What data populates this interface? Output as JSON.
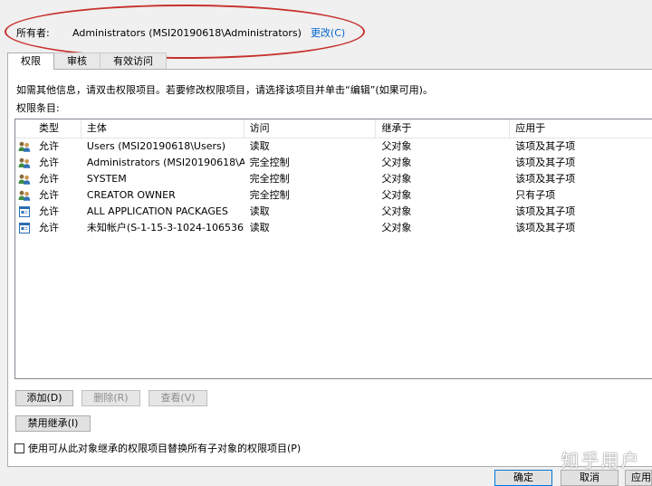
{
  "owner": {
    "label": "所有者:",
    "value": "Administrators (MSI20190618\\Administrators)",
    "change_link": "更改(C)"
  },
  "tabs": [
    {
      "label": "权限",
      "active": true
    },
    {
      "label": "审核",
      "active": false
    },
    {
      "label": "有效访问",
      "active": false
    }
  ],
  "instructions": "如需其他信息，请双击权限项目。若要修改权限项目，请选择该项目并单击“编辑”(如果可用)。",
  "entries_label": "权限条目:",
  "grid": {
    "headers": [
      "类型",
      "主体",
      "访问",
      "继承于",
      "应用于"
    ],
    "rows": [
      {
        "icon": "user-group-icon",
        "type": "允许",
        "principal": "Users (MSI20190618\\Users)",
        "access": "读取",
        "inherited_from": "父对象",
        "applies_to": "该项及其子项"
      },
      {
        "icon": "user-group-icon",
        "type": "允许",
        "principal": "Administrators (MSI20190618\\A...",
        "access": "完全控制",
        "inherited_from": "父对象",
        "applies_to": "该项及其子项"
      },
      {
        "icon": "user-group-icon",
        "type": "允许",
        "principal": "SYSTEM",
        "access": "完全控制",
        "inherited_from": "父对象",
        "applies_to": "该项及其子项"
      },
      {
        "icon": "user-group-icon",
        "type": "允许",
        "principal": "CREATOR OWNER",
        "access": "完全控制",
        "inherited_from": "父对象",
        "applies_to": "只有子项"
      },
      {
        "icon": "app-package-icon",
        "type": "允许",
        "principal": "ALL APPLICATION PACKAGES",
        "access": "读取",
        "inherited_from": "父对象",
        "applies_to": "该项及其子项"
      },
      {
        "icon": "app-package-icon",
        "type": "允许",
        "principal": "未知帐户(S-1-15-3-1024-1065365...",
        "access": "读取",
        "inherited_from": "父对象",
        "applies_to": "该项及其子项"
      }
    ]
  },
  "buttons": {
    "add": "添加(D)",
    "remove": "删除(R)",
    "view": "查看(V)",
    "disable_inheritance": "禁用继承(I)",
    "ok": "确定",
    "cancel": "取消",
    "apply": "应用"
  },
  "replace_checkbox": {
    "label": "使用可从此对象继承的权限项目替换所有子对象的权限项目(P)",
    "checked": false
  },
  "watermark": "知乎用户",
  "colors": {
    "highlight": "#c7322e",
    "link": "#0066cc",
    "primary_button_border": "#0078d7"
  }
}
